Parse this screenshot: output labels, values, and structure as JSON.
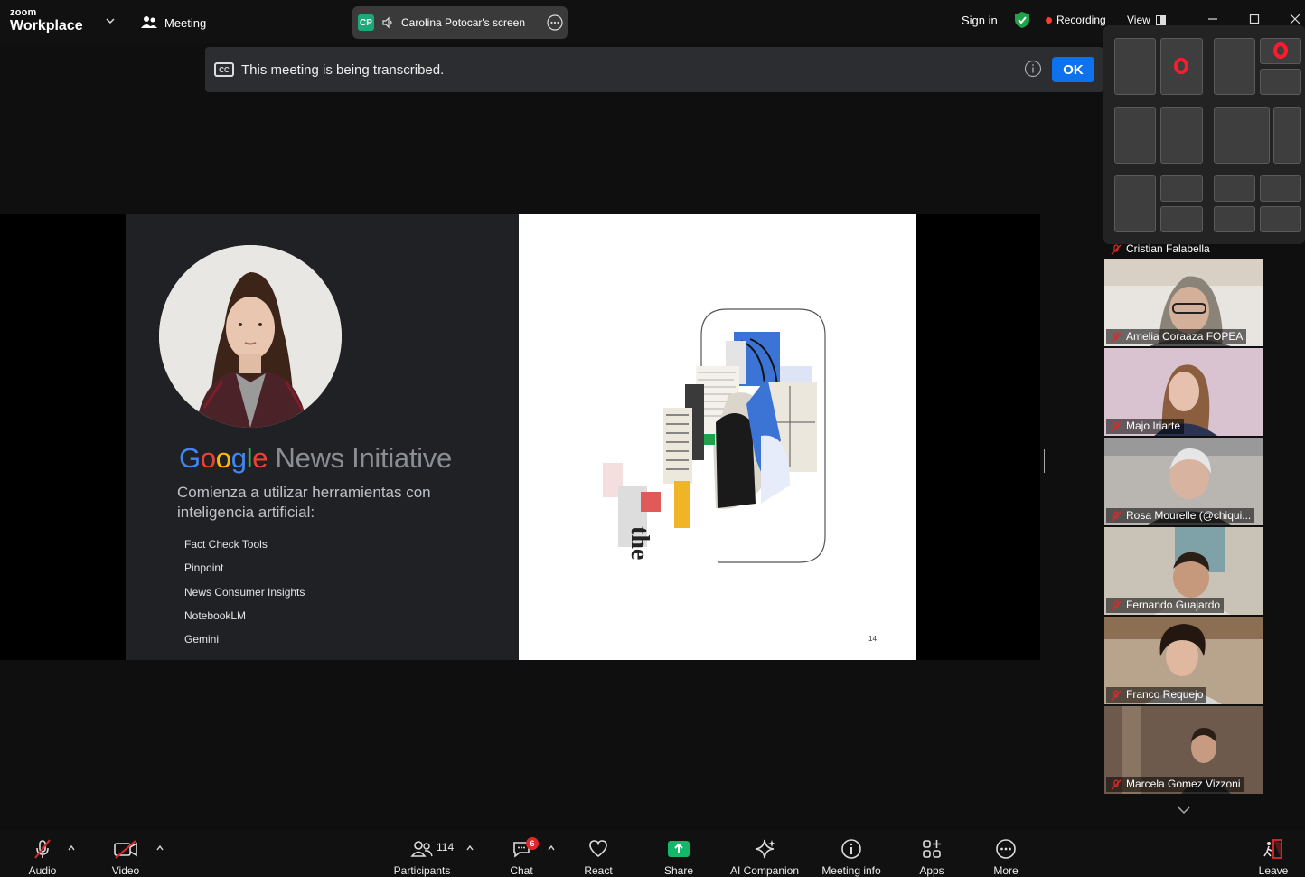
{
  "app": {
    "logo_line1": "zoom",
    "logo_line2": "Workplace",
    "meeting_label": "Meeting",
    "sign_in": "Sign in",
    "recording": "Recording",
    "view": "View"
  },
  "screen_share_pill": {
    "initials": "CP",
    "name": "Carolina Potocar's screen"
  },
  "banner": {
    "text": "This meeting is being transcribed.",
    "cc_label": "CC",
    "ok_label": "OK"
  },
  "slide": {
    "brand": [
      "G",
      "o",
      "o",
      "g",
      "l",
      "e"
    ],
    "brand_colors": [
      "#4285f4",
      "#ea4335",
      "#fbbc05",
      "#4285f4",
      "#34a853",
      "#ea4335"
    ],
    "subtitle": " News Initiative",
    "intro": "Comienza a utilizar herramientas con inteligencia artificial:",
    "tools": [
      "Fact Check Tools",
      "Pinpoint",
      "News Consumer Insights",
      "NotebookLM",
      "Gemini"
    ],
    "page_number": "14"
  },
  "participants": [
    {
      "name": "Cristian Falabella"
    },
    {
      "name": "Amelia Coraaza FOPEA"
    },
    {
      "name": "Majo Iriarte"
    },
    {
      "name": "Rosa Mourelle (@chiqui..."
    },
    {
      "name": "Fernando Guajardo"
    },
    {
      "name": "Franco Requejo"
    },
    {
      "name": "Marcela Gomez Vizzoni"
    }
  ],
  "toolbar": {
    "audio": "Audio",
    "video": "Video",
    "participants": "Participants",
    "participants_count": "114",
    "chat": "Chat",
    "chat_badge": "6",
    "react": "React",
    "share": "Share",
    "ai_companion": "AI Companion",
    "meeting_info": "Meeting info",
    "apps": "Apps",
    "more": "More",
    "leave": "Leave"
  },
  "colors": {
    "accent_blue": "#0e72ed",
    "share_green": "#12b76a",
    "record_red": "#ff3b30",
    "mute_red": "#e02828"
  }
}
